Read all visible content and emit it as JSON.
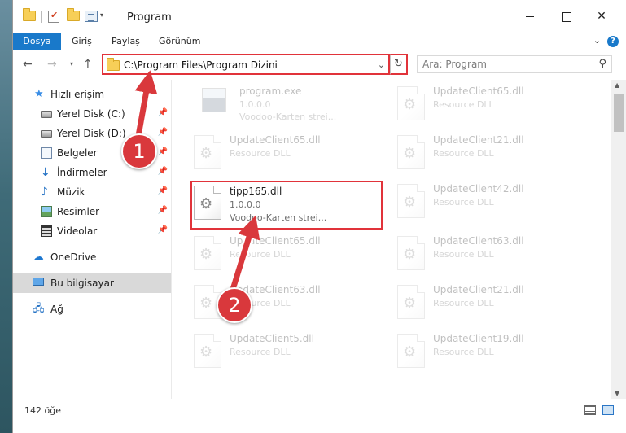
{
  "window": {
    "title": "Program",
    "qa_dropdown": "▾"
  },
  "ribbon": {
    "tabs": [
      "Dosya",
      "Giriş",
      "Paylaş",
      "Görünüm"
    ],
    "help": "?",
    "collapse": "⌄"
  },
  "address": {
    "path": "C:\\Program Files\\Program Dizini",
    "search_placeholder": "Ara: Program"
  },
  "nav": {
    "items": [
      {
        "label": "Hızlı erişim",
        "icon": "star-icon",
        "pinned": false
      },
      {
        "label": "Yerel Disk (C:)",
        "icon": "drive-icon",
        "pinned": true
      },
      {
        "label": "Yerel Disk (D:)",
        "icon": "drive-icon",
        "pinned": true
      },
      {
        "label": "Belgeler",
        "icon": "documents-icon",
        "pinned": true
      },
      {
        "label": "İndirmeler",
        "icon": "download-icon",
        "pinned": true
      },
      {
        "label": "Müzik",
        "icon": "music-icon",
        "pinned": true
      },
      {
        "label": "Resimler",
        "icon": "pictures-icon",
        "pinned": true
      },
      {
        "label": "Videolar",
        "icon": "videos-icon",
        "pinned": true
      },
      {
        "label": "OneDrive",
        "icon": "onedrive-icon",
        "pinned": false
      },
      {
        "label": "Bu bilgisayar",
        "icon": "computer-icon",
        "pinned": false,
        "selected": true
      },
      {
        "label": "Ağ",
        "icon": "network-icon",
        "pinned": false
      }
    ]
  },
  "files": {
    "left": [
      {
        "name": "program.exe",
        "line1": "1.0.0.0",
        "line2": "Voodoo-Karten strei...",
        "faded": true,
        "type": "exe"
      },
      {
        "name": "UpdateClient65.dll",
        "line1": "Resource DLL",
        "faded": true
      },
      {
        "name": "tipp165.dll",
        "line1": "1.0.0.0",
        "line2": "Voodoo-Karten strei...",
        "faded": false,
        "highlight": true
      },
      {
        "name": "UpdateClient65.dll",
        "line1": "Resource DLL",
        "faded": true
      },
      {
        "name": "UpdateClient63.dll",
        "line1": "Resource DLL",
        "faded": true
      },
      {
        "name": "UpdateClient5.dll",
        "line1": "Resource DLL",
        "faded": true
      }
    ],
    "right": [
      {
        "name": "UpdateClient65.dll",
        "line1": "Resource DLL"
      },
      {
        "name": "UpdateClient21.dll",
        "line1": "Resource DLL"
      },
      {
        "name": "UpdateClient42.dll",
        "line1": "Resource DLL"
      },
      {
        "name": "UpdateClient63.dll",
        "line1": "Resource DLL"
      },
      {
        "name": "UpdateClient21.dll",
        "line1": "Resource DLL"
      },
      {
        "name": "UpdateClient19.dll",
        "line1": "Resource DLL"
      }
    ]
  },
  "status": {
    "count": "142 öğe"
  },
  "annotations": {
    "step1": "1",
    "step2": "2",
    "color": "#d9383c"
  }
}
